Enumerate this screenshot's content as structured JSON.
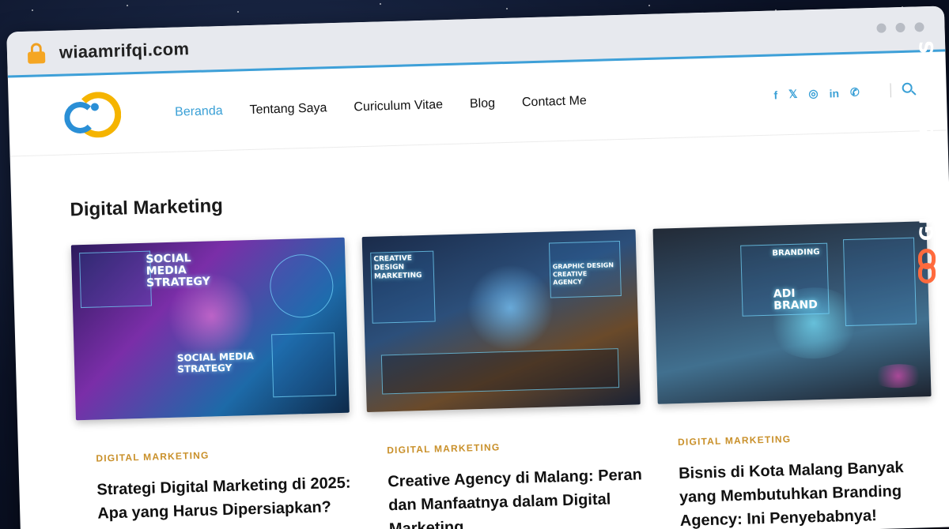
{
  "browser": {
    "url": "wiaamrifqi.com"
  },
  "nav": {
    "items": [
      "Beranda",
      "Tentang Saya",
      "Curiculum Vitae",
      "Blog",
      "Contact Me"
    ],
    "active_index": 0
  },
  "social": {
    "icons": [
      "facebook-icon",
      "x-icon",
      "instagram-icon",
      "linkedin-icon",
      "whatsapp-icon"
    ],
    "glyphs": [
      "f",
      "𝕏",
      "◎",
      "in",
      "✆"
    ]
  },
  "page": {
    "title": "Digital Marketing"
  },
  "posts": [
    {
      "category": "DIGITAL MARKETING",
      "title": "Strategi Digital Marketing di 2025: Apa yang Harus Dipersiapkan?",
      "image_texts": [
        "SOCIAL MEDIA STRATEGY",
        "SOCIAL MEDIA STRATEGY"
      ]
    },
    {
      "category": "DIGITAL MARKETING",
      "title": "Creative Agency di Malang: Peran dan Manfaatnya dalam Digital Marketing",
      "image_texts": [
        "CREATIVE DESIGN MARKETING",
        "GRAPHIC DESIGN CREATIVE AGENCY"
      ]
    },
    {
      "category": "DIGITAL MARKETING",
      "title": "Bisnis di Kota Malang Banyak yang Membutuhkan Branding Agency: Ini Penyebabnya!",
      "image_texts": [
        "BRANDING",
        "ADI BRAND"
      ]
    }
  ],
  "watermark": {
    "text": "GUESTPOSTLINKS"
  },
  "colors": {
    "accent": "#3aa0d6",
    "category": "#c9902a",
    "brand": "#ff6a3d"
  }
}
